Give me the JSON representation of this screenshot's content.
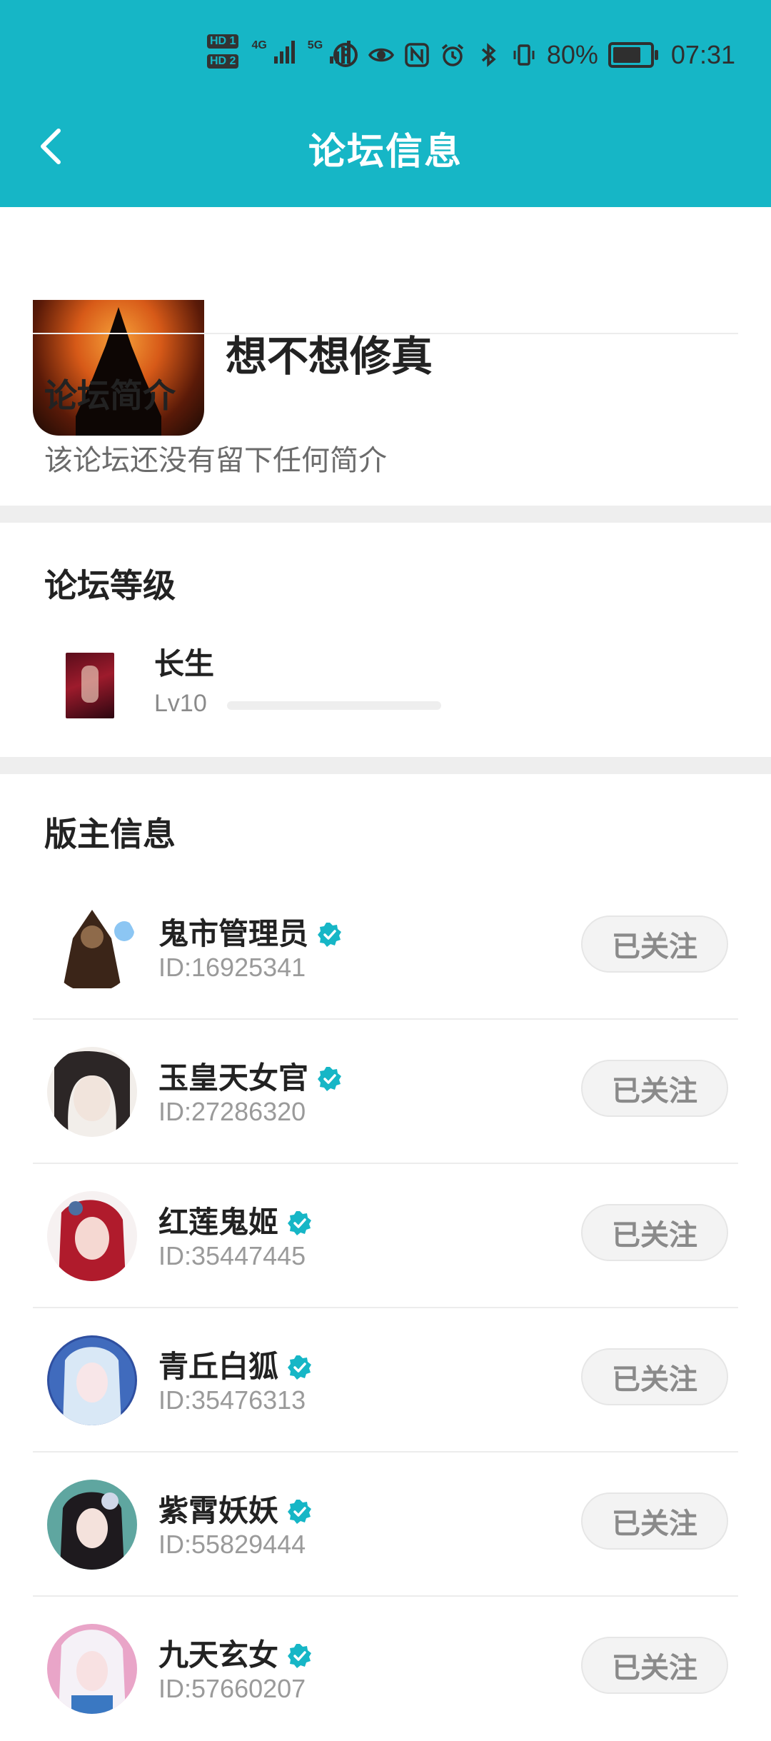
{
  "status_bar": {
    "hd1": "HD 1",
    "hd2": "HD 2",
    "net1": "4G",
    "net2": "5G",
    "battery_pct": "80%",
    "time": "07:31",
    "icons": [
      "data-saver-icon",
      "eye-icon",
      "nfc-icon",
      "alarm-icon",
      "bluetooth-icon",
      "vibrate-icon",
      "battery-icon"
    ]
  },
  "header": {
    "title": "论坛信息",
    "back_icon": "back-arrow-icon",
    "color": "#16B6C6"
  },
  "forum": {
    "name": "想不想修真"
  },
  "intro": {
    "title": "论坛简介",
    "text": "该论坛还没有留下任何简介"
  },
  "level": {
    "title": "论坛等级",
    "name": "长生",
    "code": "Lv10",
    "progress": 0
  },
  "moderators": {
    "title": "版主信息",
    "follow_label": "已关注",
    "items": [
      {
        "name": "鬼市管理员",
        "id": "ID:16925341"
      },
      {
        "name": "玉皇天女官",
        "id": "ID:27286320"
      },
      {
        "name": "红莲鬼姬",
        "id": "ID:35447445"
      },
      {
        "name": "青丘白狐",
        "id": "ID:35476313"
      },
      {
        "name": "紫霄妖妖",
        "id": "ID:55829444"
      },
      {
        "name": "九天玄女",
        "id": "ID:57660207"
      }
    ]
  }
}
